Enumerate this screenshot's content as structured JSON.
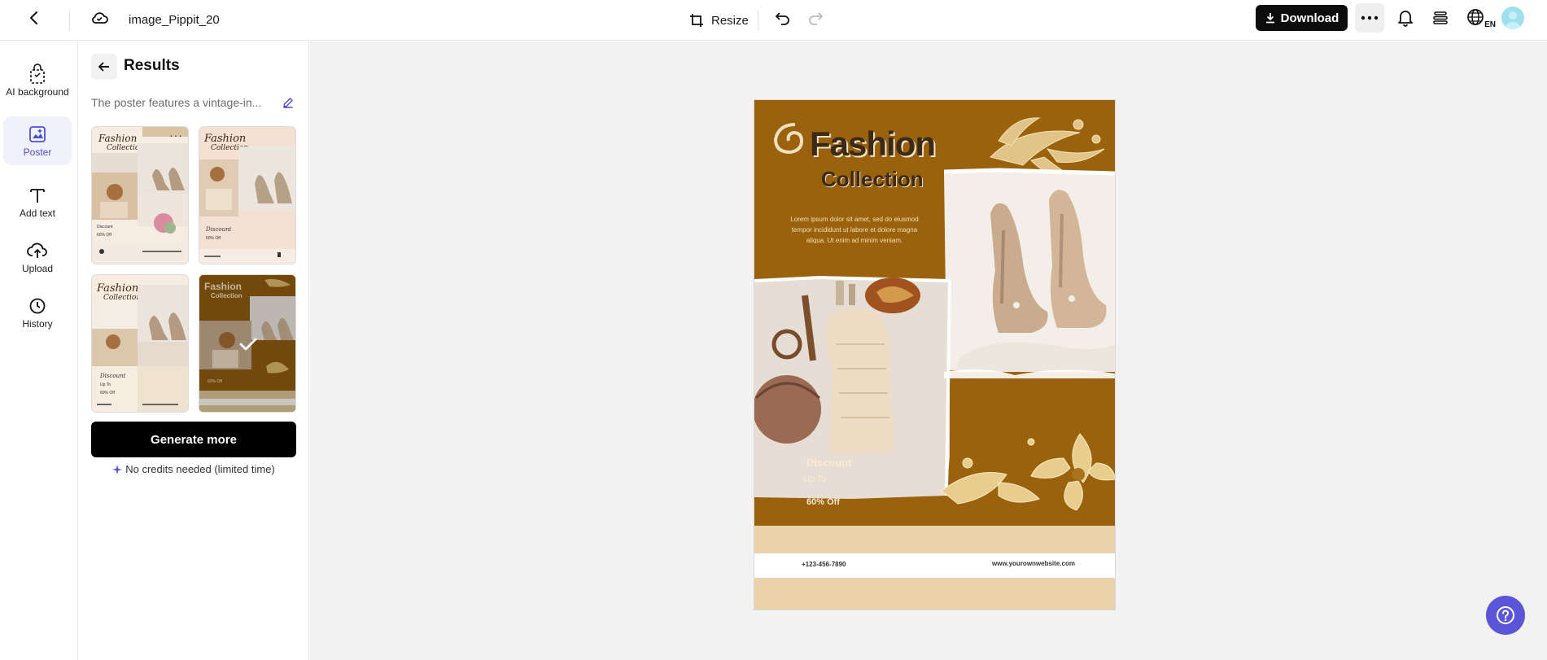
{
  "topbar": {
    "file_name": "image_Pippit_20",
    "resize_label": "Resize",
    "download_label": "Download",
    "language_badge": "EN"
  },
  "leftnav": {
    "items": [
      {
        "label": "AI background",
        "icon": "ai-background-icon"
      },
      {
        "label": "Poster",
        "icon": "poster-icon",
        "active": true
      },
      {
        "label": "Add text",
        "icon": "text-icon"
      },
      {
        "label": "Upload",
        "icon": "upload-icon"
      },
      {
        "label": "History",
        "icon": "history-icon"
      }
    ]
  },
  "panel": {
    "title": "Results",
    "prompt": "The poster features a vintage-in...",
    "generate_label": "Generate more",
    "credits_note": "No credits needed (limited time)",
    "selected_thumbnail": 4
  },
  "poster": {
    "title_line1": "Fashion",
    "title_line2": "Collection",
    "body": "Lorem ipsum dolor sit amet, sed do eiusmod tempor incididunt ut labore et dolore magna aliqua. Ut enim ad minim veniam.",
    "discount": "Discount",
    "up_to": "Up To",
    "off": "60% Off",
    "phone": "+123-456-7890",
    "website": "www.yourownwebsite.com"
  },
  "colors": {
    "accent": "#4b4fd6",
    "help_button": "#5b55d9",
    "poster_brown": "#9a620c",
    "poster_cream": "#ead3aa"
  }
}
